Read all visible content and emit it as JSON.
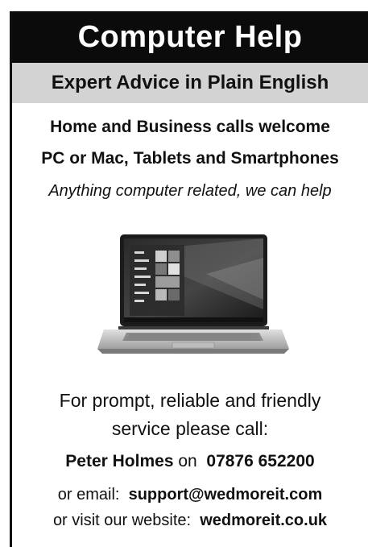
{
  "ad": {
    "title": "Computer Help",
    "subtitle": "Expert Advice in Plain English",
    "line1": "Home and Business calls welcome",
    "line2": "PC or Mac, Tablets and Smartphones",
    "line3": "Anything computer related, we can help",
    "cta_line1": "For prompt, reliable and friendly",
    "cta_line2": "service please call:",
    "contact_name": "Peter Holmes",
    "contact_on": "on",
    "phone": "07876 652200",
    "email_label": "or email:",
    "email": "support@wedmoreit.com",
    "website_label": "or visit our website:",
    "website": "wedmoreit.co.uk",
    "image_icon": "laptop-icon"
  },
  "colors": {
    "title_bg": "#0b0b0b",
    "title_text": "#ffffff",
    "subtitle_bg": "#d3d3d3",
    "text": "#111111"
  }
}
